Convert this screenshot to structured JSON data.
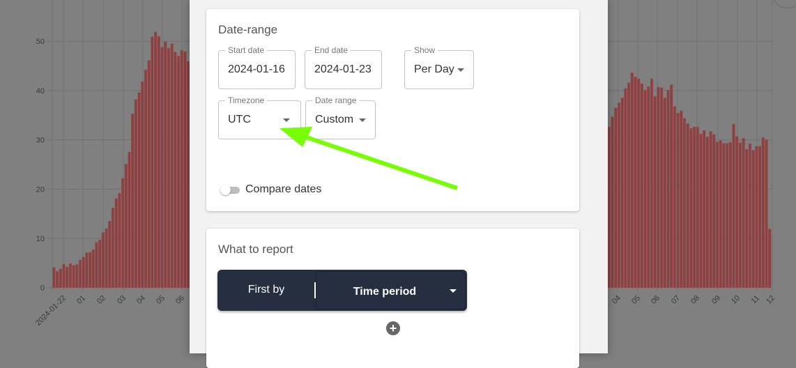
{
  "chart_data": {
    "type": "bar",
    "y_ticks": [
      "0",
      "10",
      "20",
      "30",
      "40",
      "50"
    ],
    "ylim": [
      0,
      55
    ],
    "grid": true,
    "bar_color": "#8a4141",
    "x_ticks_left": [
      "2024-01-22",
      "01",
      "02",
      "03",
      "04",
      "05",
      "06"
    ],
    "x_ticks_right": [
      "04",
      "05",
      "06",
      "07",
      "08",
      "09",
      "10",
      "11",
      "12"
    ],
    "visible_values_left": [
      4.1,
      3.3,
      3.8,
      4.8,
      4.2,
      4.9,
      4.5,
      4.7,
      5.6,
      6.2,
      7.1,
      7.2,
      7.7,
      9.2,
      9.7,
      11.2,
      12.0,
      13.5,
      16.2,
      18.1,
      19.2,
      22.2,
      25.1,
      27.5,
      35.3,
      38.2,
      39.6,
      41.8,
      44.2,
      46.1,
      50.9,
      51.9,
      51.0,
      48.8,
      49.9,
      48.6,
      49.5,
      47.8,
      47.0,
      48.2,
      47.9,
      45.9
    ],
    "visible_values_right": [
      32.6,
      34.7,
      36.5,
      37.5,
      38.5,
      40.4,
      41.6,
      43.6,
      42.8,
      42.4,
      41.4,
      40.1,
      40.8,
      42.4,
      38.8,
      40.7,
      40.6,
      38.5,
      40.1,
      41.2,
      36.8,
      35.4,
      35.9,
      34.4,
      33.3,
      32.3,
      32.6,
      32.6,
      31.2,
      31.9,
      30.6,
      31.7,
      31.1,
      29.6,
      29.9,
      29.3,
      29.3,
      29.5,
      33.2,
      30.7,
      29.4,
      30.3,
      28.1,
      29.2,
      27.9,
      28.7,
      28.7,
      30.5,
      30.0,
      11.9
    ]
  },
  "modal": {
    "date_range": {
      "title": "Date-range",
      "start_date": {
        "label": "Start date",
        "value": "2024-01-16"
      },
      "end_date": {
        "label": "End date",
        "value": "2024-01-23"
      },
      "show": {
        "label": "Show",
        "value": "Per Day"
      },
      "timezone": {
        "label": "Timezone",
        "value": "UTC"
      },
      "range": {
        "label": "Date range",
        "value": "Custom"
      },
      "compare": {
        "label": "Compare dates",
        "on": false
      }
    },
    "report": {
      "title": "What to report",
      "first_by": "First by",
      "group_value": "Time period",
      "add_icon": "plus-circle-icon"
    }
  },
  "annotation": {
    "arrow_color": "#76ff03"
  }
}
